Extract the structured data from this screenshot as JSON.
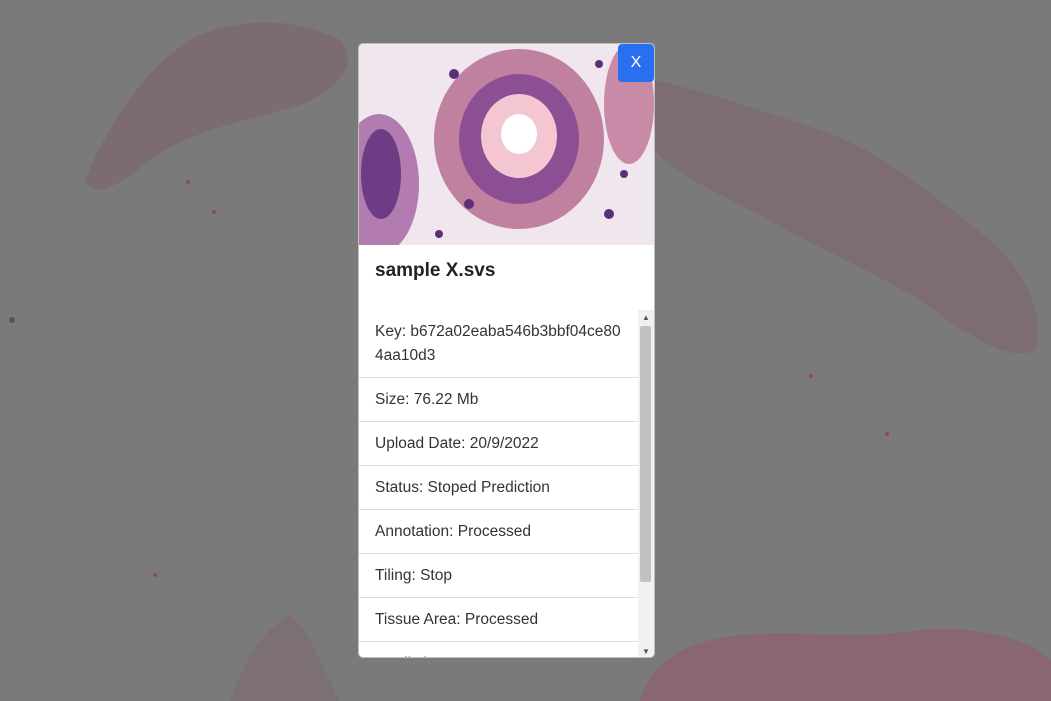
{
  "modal": {
    "close_label": "X",
    "title": "sample X.svs",
    "details": [
      "Key: b672a02eaba546b3bbf04ce804aa10d3",
      "Size: 76.22 Mb",
      "Upload Date: 20/9/2022",
      "Status: Stoped Prediction",
      "Annotation: Processed",
      "Tiling: Stop",
      "Tissue Area: Processed",
      "Prediction: Stop"
    ]
  },
  "colors": {
    "overlay": "#7a7a7a",
    "close_button": "#2a6ff0",
    "tissue_pink": "#a0606e"
  },
  "icons": {
    "scroll_up": "▲",
    "scroll_down": "▼"
  }
}
